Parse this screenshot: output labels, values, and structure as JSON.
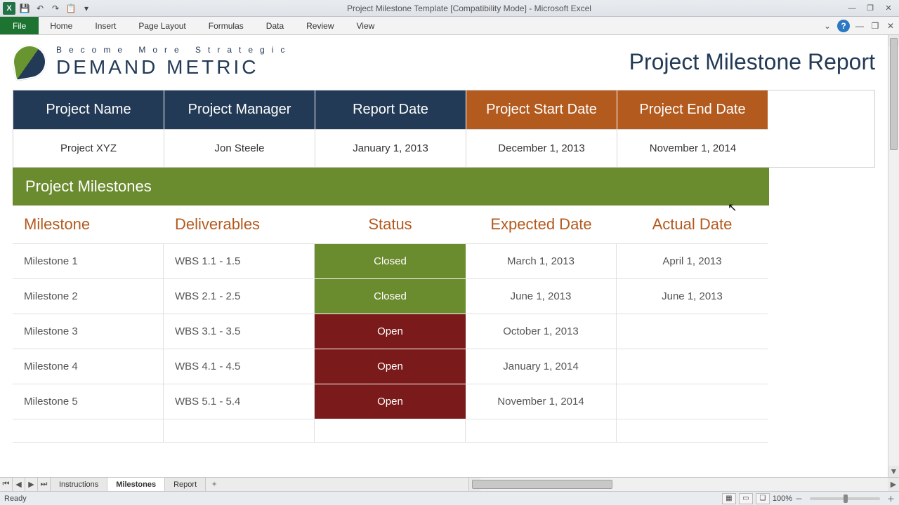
{
  "window": {
    "title": "Project Milestone Template  [Compatibility Mode]  -  Microsoft Excel"
  },
  "ribbon": {
    "tabs": [
      "File",
      "Home",
      "Insert",
      "Page Layout",
      "Formulas",
      "Data",
      "Review",
      "View"
    ]
  },
  "logo": {
    "tagline": "Become More Strategic",
    "name": "DEMAND METRIC"
  },
  "report_title": "Project Milestone Report",
  "info": {
    "headers": [
      "Project Name",
      "Project Manager",
      "Report Date",
      "Project Start Date",
      "Project End Date"
    ],
    "values": [
      "Project XYZ",
      "Jon Steele",
      "January 1, 2013",
      "December 1, 2013",
      "November 1, 2014"
    ]
  },
  "section_title": "Project Milestones",
  "ms_headers": [
    "Milestone",
    "Deliverables",
    "Status",
    "Expected Date",
    "Actual Date"
  ],
  "milestones": [
    {
      "name": "Milestone 1",
      "deliv": "WBS 1.1 - 1.5",
      "status": "Closed",
      "expected": "March 1, 2013",
      "actual": "April 1, 2013"
    },
    {
      "name": "Milestone 2",
      "deliv": "WBS 2.1 - 2.5",
      "status": "Closed",
      "expected": "June 1, 2013",
      "actual": "June 1, 2013"
    },
    {
      "name": "Milestone 3",
      "deliv": "WBS 3.1 - 3.5",
      "status": "Open",
      "expected": "October 1, 2013",
      "actual": ""
    },
    {
      "name": "Milestone 4",
      "deliv": "WBS 4.1 - 4.5",
      "status": "Open",
      "expected": "January 1, 2014",
      "actual": ""
    },
    {
      "name": "Milestone 5",
      "deliv": "WBS 5.1 - 5.4",
      "status": "Open",
      "expected": "November 1, 2014",
      "actual": ""
    }
  ],
  "sheet_tabs": [
    "Instructions",
    "Milestones",
    "Report"
  ],
  "active_sheet": "Milestones",
  "status": {
    "left": "Ready",
    "zoom": "100%"
  }
}
